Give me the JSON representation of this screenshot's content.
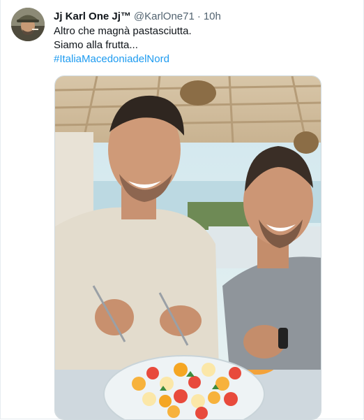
{
  "tweet": {
    "display_name": "Jj Karl One Jj™",
    "handle": "@KarlOne71",
    "separator": "·",
    "time": "10h",
    "text_lines": [
      "Altro che magnà pastasciutta.",
      "Siamo alla frutta..."
    ],
    "hashtag": "#ItaliaMacedoniadelNord"
  },
  "colors": {
    "link": "#1d9bf0",
    "secondary_text": "#536471",
    "primary_text": "#0f1419",
    "border": "#cfd9de"
  }
}
